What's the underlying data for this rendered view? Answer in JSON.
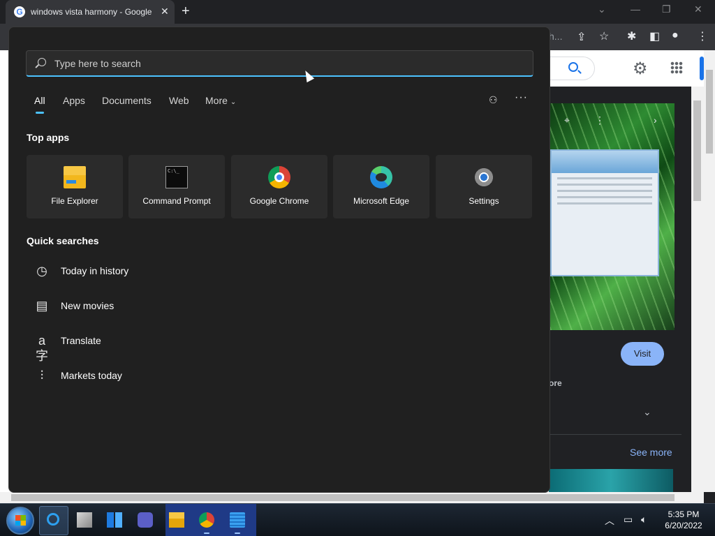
{
  "browser": {
    "tab_title": "windows vista harmony - Google",
    "tab_close": "✕",
    "new_tab": "+",
    "omnibox_tail": "h...",
    "window_controls": [
      "⌄",
      "—",
      "❐",
      "✕"
    ]
  },
  "google_page": {
    "visit_label": "Visit",
    "partial_text": "ore",
    "see_more_label": "See more"
  },
  "search_flyout": {
    "placeholder": "Type here to search",
    "tabs": [
      "All",
      "Apps",
      "Documents",
      "Web",
      "More"
    ],
    "active_tab": "All",
    "top_apps_heading": "Top apps",
    "top_apps": [
      {
        "label": "File Explorer",
        "icon": "file-explorer-icon"
      },
      {
        "label": "Command Prompt",
        "icon": "command-prompt-icon"
      },
      {
        "label": "Google Chrome",
        "icon": "chrome-icon"
      },
      {
        "label": "Microsoft Edge",
        "icon": "edge-icon"
      },
      {
        "label": "Settings",
        "icon": "settings-gear-icon"
      }
    ],
    "quick_searches_heading": "Quick searches",
    "quick_searches": [
      {
        "label": "Today in history",
        "icon": "clock-icon"
      },
      {
        "label": "New movies",
        "icon": "clapperboard-icon"
      },
      {
        "label": "Translate",
        "icon": "translate-icon"
      },
      {
        "label": "Markets today",
        "icon": "chart-icon"
      }
    ]
  },
  "taskbar": {
    "time": "5:35 PM",
    "date": "6/20/2022"
  },
  "colors": {
    "accent": "#4cc2ff",
    "flyout_bg": "#202020",
    "tile_bg": "#2b2b2b",
    "taskbar_group": "#1f3a86"
  }
}
